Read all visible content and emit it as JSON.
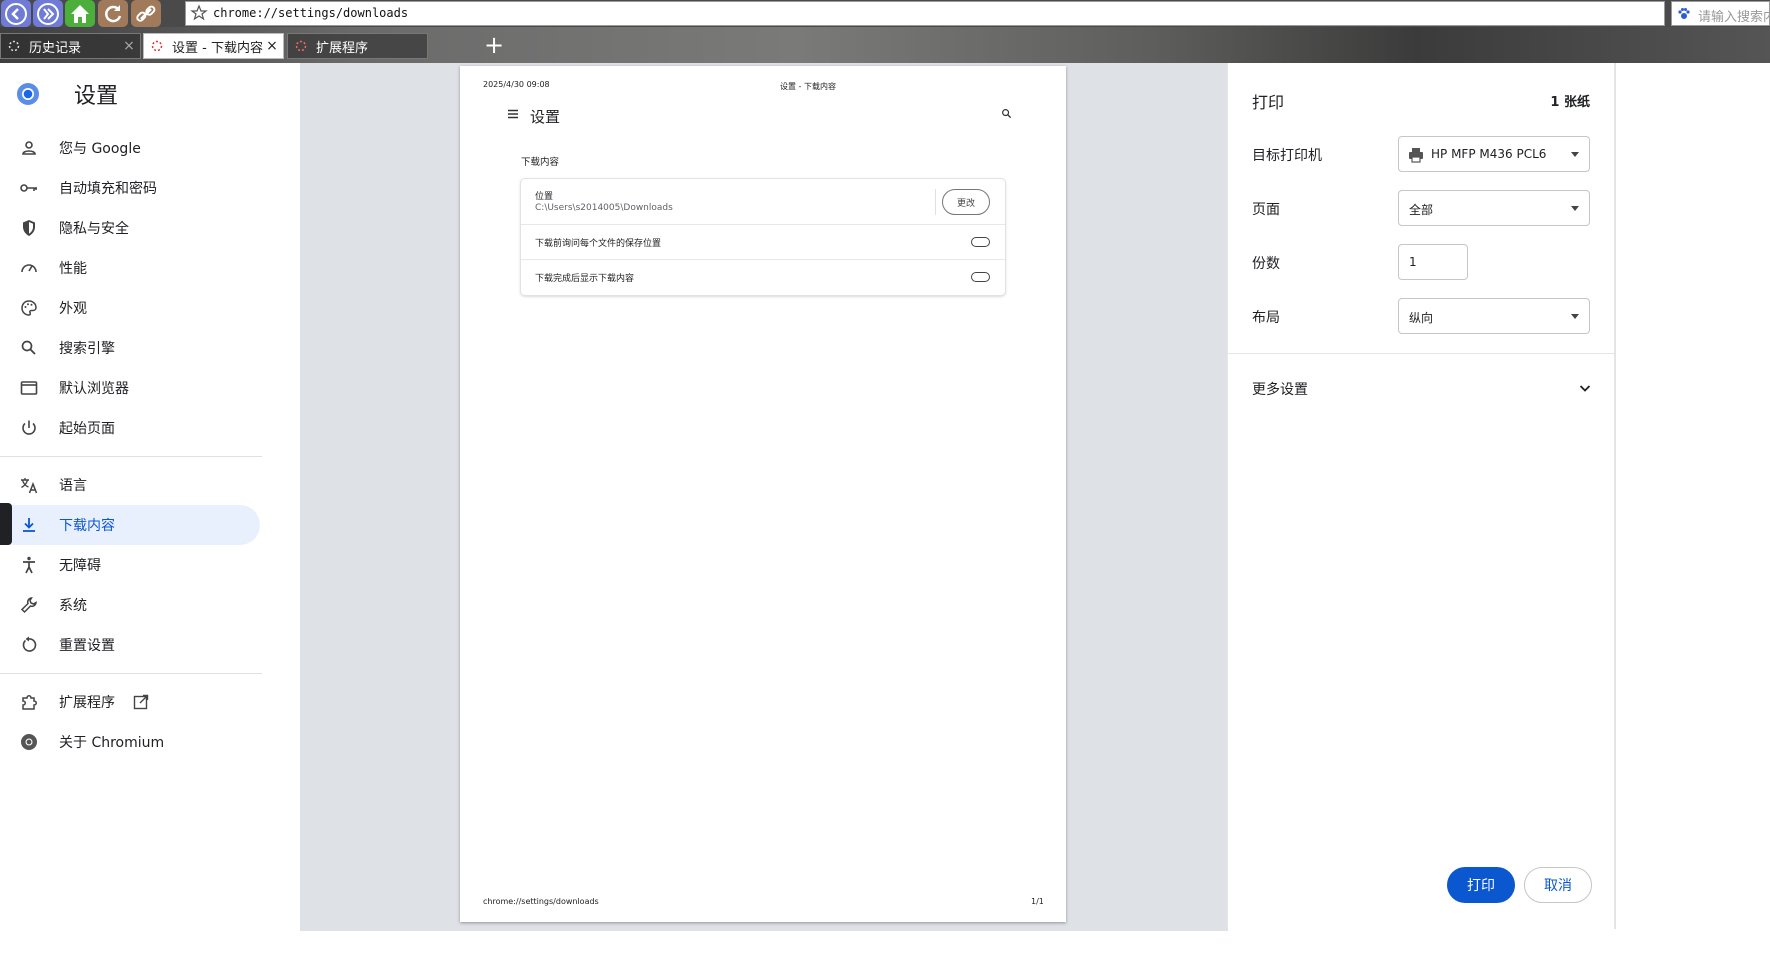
{
  "browser": {
    "address_url": "chrome://settings/downloads",
    "search_placeholder": "请输入搜索内容",
    "tabs": [
      {
        "label": "历史记录",
        "active": false
      },
      {
        "label": "设置 - 下载内容",
        "active": true
      },
      {
        "label": "扩展程序",
        "active": false
      }
    ],
    "new_tab_label": "+"
  },
  "settings": {
    "title": "设置",
    "nav": [
      {
        "label": "您与 Google",
        "icon": "person-icon"
      },
      {
        "label": "自动填充和密码",
        "icon": "key-icon"
      },
      {
        "label": "隐私与安全",
        "icon": "shield-icon"
      },
      {
        "label": "性能",
        "icon": "speedometer-icon"
      },
      {
        "label": "外观",
        "icon": "palette-icon"
      },
      {
        "label": "搜索引擎",
        "icon": "search-icon"
      },
      {
        "label": "默认浏览器",
        "icon": "browser-window-icon"
      },
      {
        "label": "起始页面",
        "icon": "power-icon"
      },
      {
        "label": "语言",
        "icon": "translate-icon"
      },
      {
        "label": "下载内容",
        "icon": "download-icon",
        "selected": true
      },
      {
        "label": "无障碍",
        "icon": "accessibility-icon"
      },
      {
        "label": "系统",
        "icon": "wrench-icon"
      },
      {
        "label": "重置设置",
        "icon": "reset-icon"
      },
      {
        "label": "扩展程序",
        "icon": "puzzle-icon"
      },
      {
        "label": "关于 Chromium",
        "icon": "chromium-icon"
      }
    ]
  },
  "preview": {
    "header_date": "2025/4/30 09:08",
    "header_title": "设置 - 下载内容",
    "page_title": "设置",
    "section_title": "下载内容",
    "location_label": "位置",
    "location_path": "C:\\Users\\s2014005\\Downloads",
    "change_button": "更改",
    "ask_where_label": "下载前询问每个文件的保存位置",
    "show_when_done_label": "下载完成后显示下载内容",
    "footer_url": "chrome://settings/downloads",
    "footer_page": "1/1"
  },
  "print_panel": {
    "title": "打印",
    "sheets": "1 张纸",
    "destination_label": "目标打印机",
    "destination_value": "HP MFP M436 PCL6",
    "pages_label": "页面",
    "pages_value": "全部",
    "copies_label": "份数",
    "copies_value": "1",
    "layout_label": "布局",
    "layout_value": "纵向",
    "more_settings": "更多设置",
    "print_button": "打印",
    "cancel_button": "取消"
  },
  "colors": {
    "accent": "#0b57d0",
    "nav_selected_bg": "#e8f0fe",
    "preview_bg": "#dee1e6"
  }
}
